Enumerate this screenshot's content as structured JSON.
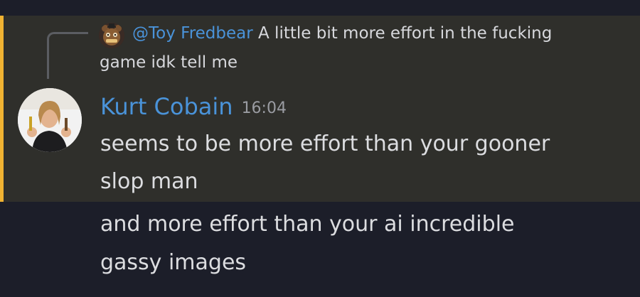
{
  "reply": {
    "author": "@Toy Fredbear",
    "text_line1": "A little bit more effort in the fucking",
    "text_line2": "game idk tell me"
  },
  "message": {
    "username": "Kurt Cobain",
    "timestamp": "16:04",
    "lines": [
      "seems to be more effort than your gooner",
      "slop man"
    ]
  },
  "followup": {
    "lines": [
      "and more effort than your ai incredible",
      "gassy images"
    ]
  },
  "colors": {
    "background": "#1c1e29",
    "highlight": "#2f2f2b",
    "mention_bar": "#f0b232",
    "username": "#4a93d9"
  }
}
